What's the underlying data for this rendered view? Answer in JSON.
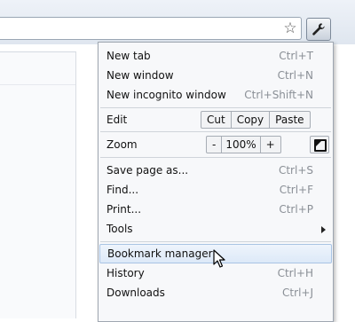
{
  "toolbar": {
    "icons": {
      "star": "star-icon",
      "wrench": "wrench-icon"
    }
  },
  "menu": {
    "items_top": [
      {
        "label": "New tab",
        "shortcut": "Ctrl+T"
      },
      {
        "label": "New window",
        "shortcut": "Ctrl+N"
      },
      {
        "label": "New incognito window",
        "shortcut": "Ctrl+Shift+N"
      }
    ],
    "edit": {
      "label": "Edit",
      "cut": "Cut",
      "copy": "Copy",
      "paste": "Paste"
    },
    "zoom": {
      "label": "Zoom",
      "minus": "-",
      "value": "100%",
      "plus": "+"
    },
    "items_mid": [
      {
        "label": "Save page as...",
        "shortcut": "Ctrl+S"
      },
      {
        "label": "Find...",
        "shortcut": "Ctrl+F"
      },
      {
        "label": "Print...",
        "shortcut": "Ctrl+P"
      },
      {
        "label": "Tools",
        "shortcut": ""
      }
    ],
    "items_bottom": [
      {
        "label": "Bookmark manager",
        "shortcut": "",
        "hovered": true
      },
      {
        "label": "History",
        "shortcut": "Ctrl+H"
      },
      {
        "label": "Downloads",
        "shortcut": "Ctrl+J"
      }
    ]
  },
  "colors": {
    "hover_bg": "#dde9f8",
    "hover_border": "#a9c4e4",
    "shortcut_text": "#8a8f96"
  }
}
